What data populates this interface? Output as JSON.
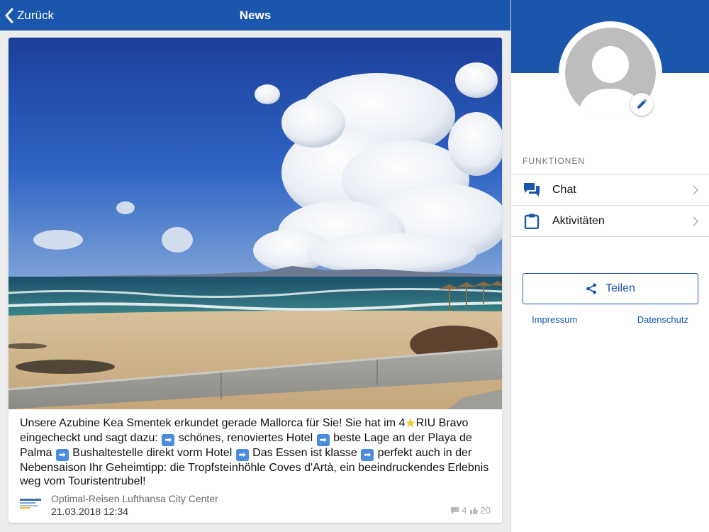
{
  "header": {
    "back_label": "Zurück",
    "title": "News",
    "back_icon": "chevron-left-icon"
  },
  "post": {
    "text_parts": {
      "p1": "Unsere Azubine Kea Smentek erkundet gerade Mallorca für Sie! Sie hat im 4",
      "p2": "RIU Bravo eingecheckt und sagt dazu:",
      "p3": "schönes, renoviertes Hotel",
      "p4": "beste Lage an der Playa de Palma",
      "p5": "Bushaltestelle direkt vorm Hotel",
      "p6": "Das Essen ist klasse",
      "p7": "perfekt auch in der Nebensaison Ihr Geheimtipp: die Tropfsteinhöhle Coves d'Artà, ein beeindruckendes Erlebnis weg vom Touristentrubel!"
    },
    "author": "Optimal-Reisen Lufthansa City Center",
    "date": "21.03.2018 12:34",
    "comments_count": "4",
    "likes_count": "20",
    "image_subject": "beach-with-clouds-photo"
  },
  "sidebar": {
    "section_title": "FUNKTIONEN",
    "menu": [
      {
        "label": "Chat",
        "icon": "chat-bubbles-icon"
      },
      {
        "label": "Aktivitäten",
        "icon": "clipboard-icon"
      }
    ],
    "share_label": "Teilen",
    "impressum_label": "Impressum",
    "datenschutz_label": "Datenschutz"
  },
  "colors": {
    "brand_blue": "#1b56ad",
    "background": "#ececec",
    "avatar_grey": "#bdbdbd"
  }
}
